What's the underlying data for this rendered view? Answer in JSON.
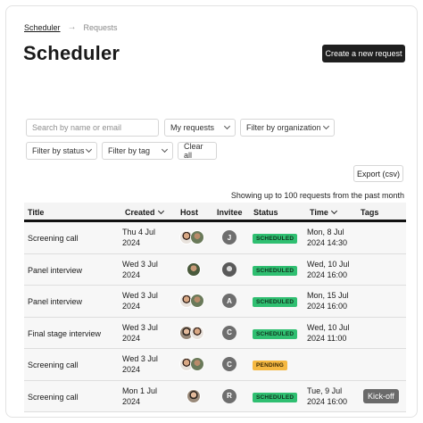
{
  "breadcrumb": {
    "root": "Scheduler",
    "separator": "→",
    "current": "Requests"
  },
  "page": {
    "title": "Scheduler",
    "create_label": "Create a new request"
  },
  "filters": {
    "search_placeholder": "Search by name or email",
    "my_requests": "My requests",
    "organization": "Filter by organization",
    "status": "Filter by status",
    "tag": "Filter by tag",
    "clear_label": "Clear all"
  },
  "export_label": "Export (csv)",
  "summary": "Showing up to 100 requests from the past month",
  "table": {
    "headers": {
      "title": "Title",
      "created": "Created",
      "host": "Host",
      "invitee": "Invitee",
      "status": "Status",
      "time": "Time",
      "tags": "Tags"
    },
    "rows": [
      {
        "title": "Screening call",
        "created_1": "Thu 4 Jul",
        "created_2": "2024",
        "invitee": "J",
        "status": "SCHEDULED",
        "time_1": "Mon, 8 Jul",
        "time_2": "2024 14:30",
        "tag": ""
      },
      {
        "title": "Panel interview",
        "created_1": "Wed 3 Jul",
        "created_2": "2024",
        "invitee": "",
        "status": "SCHEDULED",
        "time_1": "Wed, 10 Jul",
        "time_2": "2024 16:00",
        "tag": ""
      },
      {
        "title": "Panel interview",
        "created_1": "Wed 3 Jul",
        "created_2": "2024",
        "invitee": "A",
        "status": "SCHEDULED",
        "time_1": "Mon, 15 Jul",
        "time_2": "2024 16:00",
        "tag": ""
      },
      {
        "title": "Final stage interview",
        "created_1": "Wed 3 Jul",
        "created_2": "2024",
        "invitee": "C",
        "status": "SCHEDULED",
        "time_1": "Wed, 10 Jul",
        "time_2": "2024 11:00",
        "tag": ""
      },
      {
        "title": "Screening call",
        "created_1": "Wed 3 Jul",
        "created_2": "2024",
        "invitee": "C",
        "status": "PENDING",
        "time_1": "",
        "time_2": "",
        "tag": ""
      },
      {
        "title": "Screening call",
        "created_1": "Mon 1 Jul",
        "created_2": "2024",
        "invitee": "R",
        "status": "SCHEDULED",
        "time_1": "Tue, 9 Jul",
        "time_2": "2024 16:00",
        "tag": "Kick-off"
      }
    ]
  },
  "colors": {
    "scheduled": "#2fbf71",
    "pending": "#f5b841",
    "primary_button": "#1f1f1f"
  }
}
